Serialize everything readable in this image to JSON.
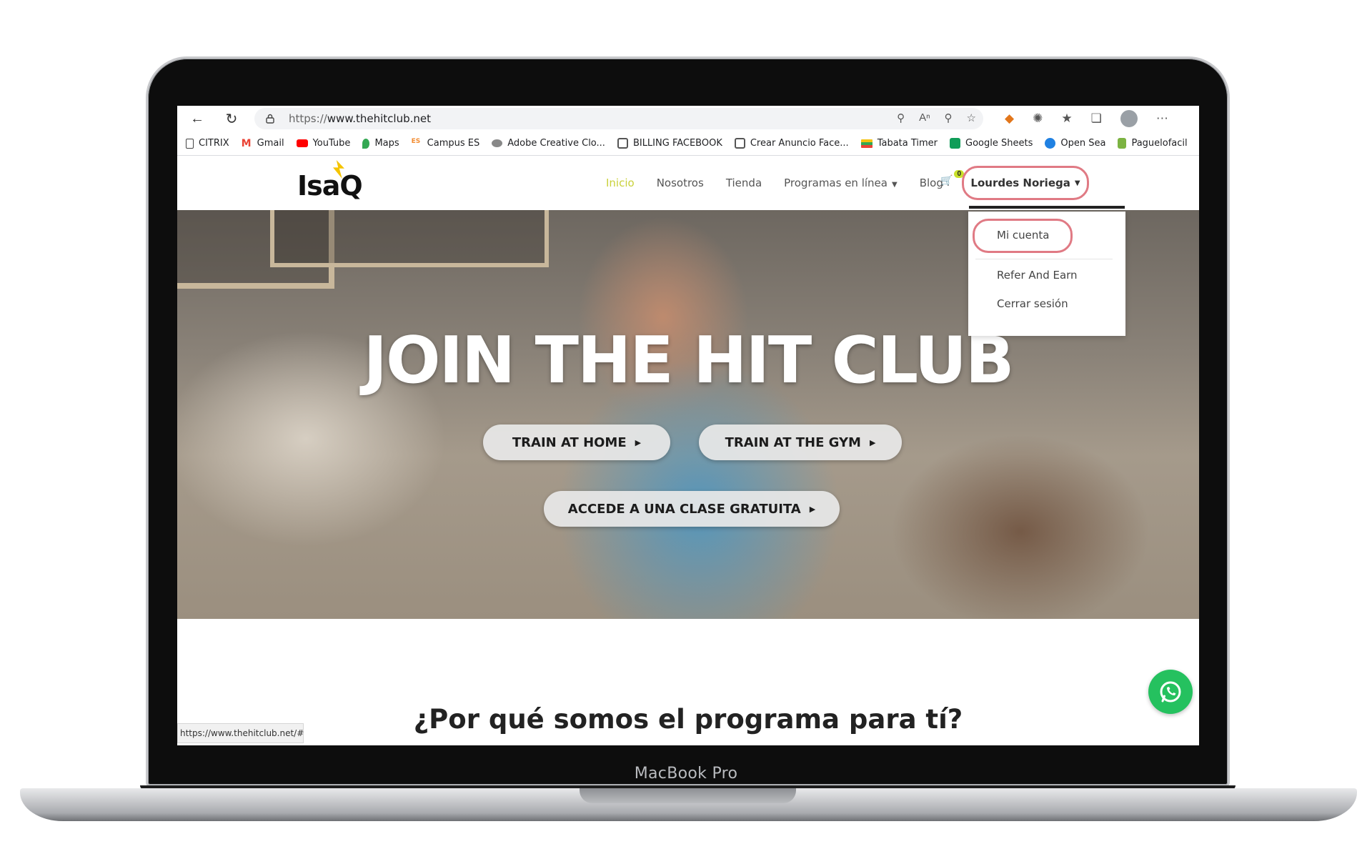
{
  "device": {
    "label": "MacBook Pro"
  },
  "browser": {
    "url_scheme": "https://",
    "url_host": "www.thehitclub.net",
    "status_url": "https://www.thehitclub.net/#"
  },
  "bookmarks": [
    {
      "label": "CITRIX",
      "icon": "page-icon",
      "color": "#ffffff"
    },
    {
      "label": "Gmail",
      "icon": "gmail-icon",
      "color": "#ea4335"
    },
    {
      "label": "YouTube",
      "icon": "youtube-icon",
      "color": "#ff0000"
    },
    {
      "label": "Maps",
      "icon": "maps-icon",
      "color": "#34a853"
    },
    {
      "label": "Campus ES",
      "icon": "campus-icon",
      "color": "#f28b30"
    },
    {
      "label": "Adobe Creative Clo...",
      "icon": "adobe-icon",
      "color": "#888888"
    },
    {
      "label": "BILLING FACEBOOK",
      "icon": "billing-icon",
      "color": "#555555"
    },
    {
      "label": "Crear Anuncio Face...",
      "icon": "ad-icon",
      "color": "#555555"
    },
    {
      "label": "Tabata Timer",
      "icon": "timer-icon",
      "color": "#f4c20d"
    },
    {
      "label": "Google Sheets",
      "icon": "sheets-icon",
      "color": "#0f9d58"
    },
    {
      "label": "Open Sea",
      "icon": "opensea-icon",
      "color": "#2081e2"
    },
    {
      "label": "Paguelofacil",
      "icon": "paguelofacil-icon",
      "color": "#7cb342"
    }
  ],
  "site": {
    "logo_text": "IsaQ",
    "nav": {
      "home": "Inicio",
      "about": "Nosotros",
      "shop": "Tienda",
      "programs": "Programas en línea",
      "blog": "Blog"
    },
    "cart_count": "0",
    "user_name": "Lourdes Noriega",
    "dropdown": {
      "account": "Mi cuenta",
      "refer": "Refer And Earn",
      "logout": "Cerrar sesión"
    }
  },
  "hero": {
    "title": "JOIN THE HIT CLUB",
    "cta_home": "TRAIN AT HOME",
    "cta_gym": "TRAIN AT THE GYM",
    "cta_free": "ACCEDE A UNA CLASE GRATUITA"
  },
  "section": {
    "title": "¿Por qué somos el programa para tí?"
  },
  "colors": {
    "accent_nav": "#c9d13a",
    "highlight_ring": "#e07a84",
    "whatsapp": "#25c15f"
  }
}
